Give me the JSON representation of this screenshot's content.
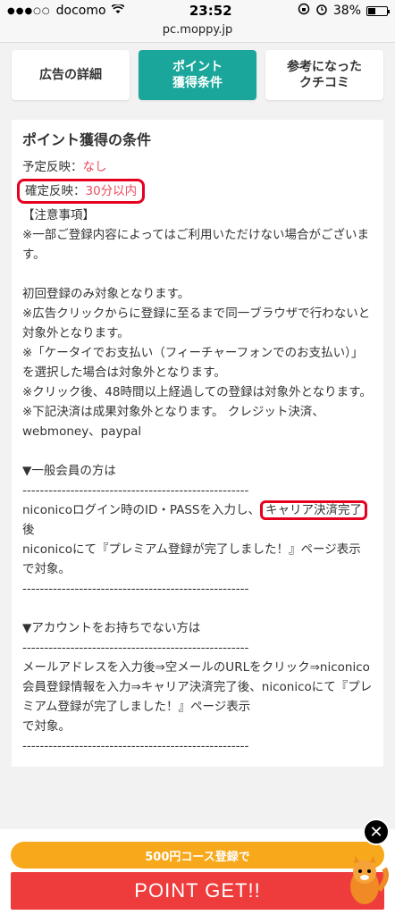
{
  "status_bar": {
    "carrier": "docomo",
    "time": "23:52",
    "battery": "38%",
    "battery_level": 0.38
  },
  "url": "pc.moppy.jp",
  "tabs": [
    {
      "label": "広告の詳細",
      "active": false
    },
    {
      "label": "ポイント\n獲得条件",
      "active": true
    },
    {
      "label": "参考になった\nクチコミ",
      "active": false
    }
  ],
  "content": {
    "title": "ポイント獲得の条件",
    "scheduled_label": "予定反映：",
    "scheduled_value": "なし",
    "confirmed_label": "確定反映：",
    "confirmed_value": "30分以内",
    "notes_pre": "【注意事項】\n※一部ご登録内容によってはご利用いただけない場合がございます。\n\n初回登録のみ対象となります。\n※広告クリックからに登録に至るまで同一ブラウザで行わないと対象外となります。\n※「ケータイでお支払い（フィーチャーフォンでのお支払い）」を選択した場合は対象外となります。\n※クリック後、48時間以上経過しての登録は対象外となります。\n※下記決済は成果対象外となります。 クレジット決済、webmoney、paypal\n\n▼一般会員の方は\n----------------------------------------------------",
    "general_line_a": "niconicoログイン時のID・PASSを入力し、",
    "general_highlight": "キャリア決済完了",
    "general_line_b": "後\nniconicoにて『プレミアム登録が完了しました！』ページ表示\nで対象。\n----------------------------------------------------\n\n▼アカウントをお持ちでない方は\n----------------------------------------------------\nメールアドレスを入力後⇒空メールのURLをクリック⇒niconico会員登録情報を入力⇒キャリア決済完了後、niconicoにて『プレミアム登録が完了しました！』ページ表示\nで対象。\n----------------------------------------------------"
  },
  "bottom": {
    "pill_text": "500円コース登録で",
    "button_label": "POINT GET!!",
    "close_label": "✕"
  },
  "colors": {
    "accent": "#1aa69b",
    "red": "#ea4c5e",
    "orange": "#f7a81b",
    "get_red": "#ee3b3b"
  }
}
